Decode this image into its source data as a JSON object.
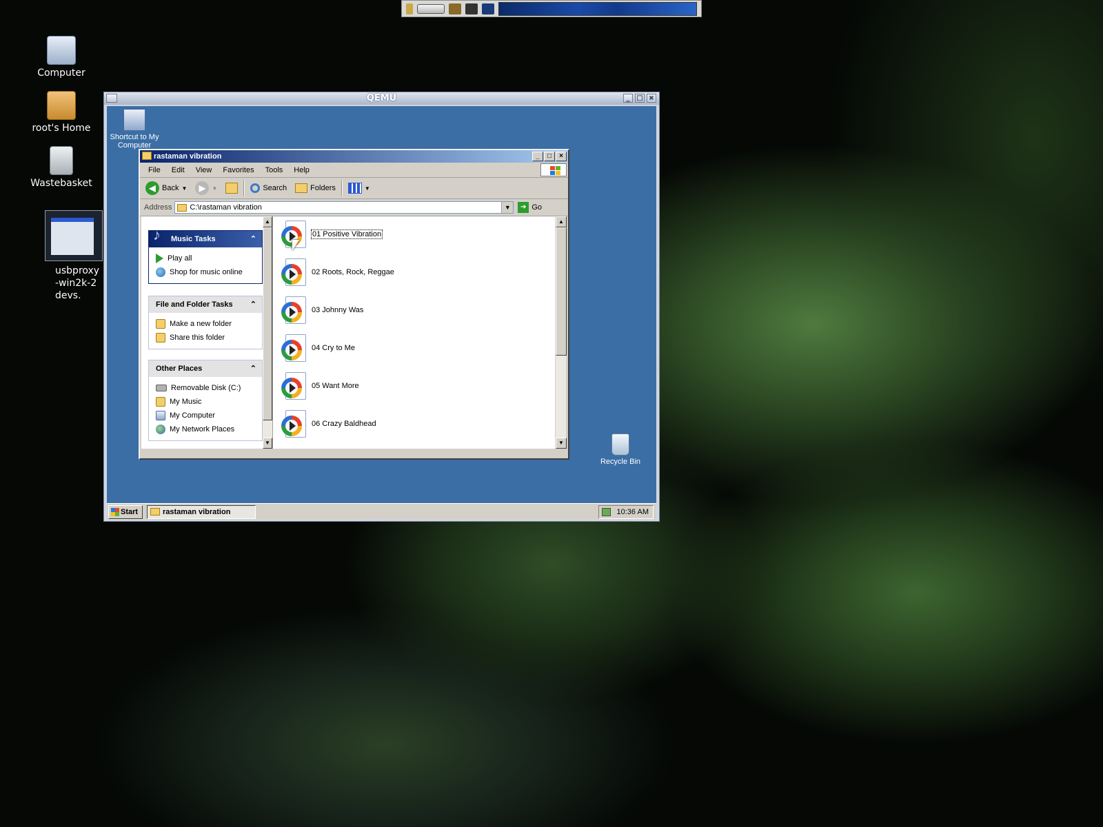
{
  "host": {
    "desktop_icons": [
      {
        "label": "Computer",
        "icon": "computer-icon"
      },
      {
        "label": "root's Home",
        "icon": "home-folder-icon"
      },
      {
        "label": "Wastebasket",
        "icon": "wastebasket-icon"
      },
      {
        "label": "usbproxy-win2k-2devs.",
        "icon": "vm-thumbnail-icon"
      }
    ]
  },
  "qemu": {
    "title": "QEMU",
    "buttons": {
      "minimize": "_",
      "maximize": "□",
      "close": "×"
    }
  },
  "guest": {
    "desktop_icons": [
      {
        "label": "Shortcut to My Computer",
        "icon": "my-computer-shortcut-icon"
      },
      {
        "label": "Recycle Bin",
        "icon": "recycle-bin-icon"
      }
    ],
    "explorer": {
      "title": "rastaman vibration",
      "menu": [
        "File",
        "Edit",
        "View",
        "Favorites",
        "Tools",
        "Help"
      ],
      "toolbar": {
        "back": "Back",
        "search": "Search",
        "folders": "Folders"
      },
      "address": {
        "label": "Address",
        "value": "C:\\rastaman vibration",
        "go": "Go"
      },
      "tasks": {
        "music": {
          "title": "Music Tasks",
          "items": [
            "Play all",
            "Shop for music online"
          ]
        },
        "file_folder": {
          "title": "File and Folder Tasks",
          "items": [
            "Make a new folder",
            "Share this folder"
          ]
        },
        "other_places": {
          "title": "Other Places",
          "items": [
            "Removable Disk (C:)",
            "My Music",
            "My Computer",
            "My Network Places"
          ]
        }
      },
      "files": [
        "01 Positive Vibration",
        "02 Roots, Rock, Reggae",
        "03 Johnny Was",
        "04 Cry to Me",
        "05 Want More",
        "06 Crazy Baldhead"
      ]
    },
    "taskbar": {
      "start": "Start",
      "task": "rastaman vibration",
      "clock": "10:36 AM"
    }
  }
}
